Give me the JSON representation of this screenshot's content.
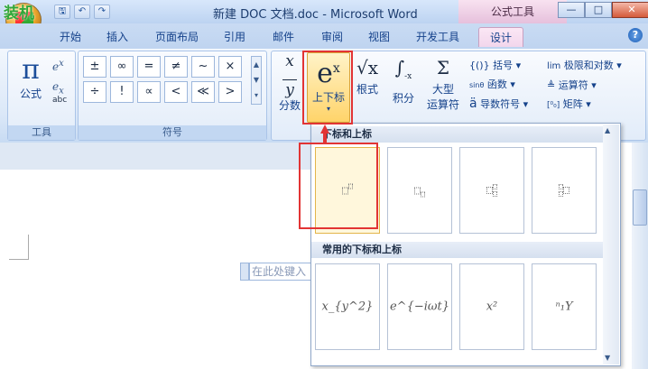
{
  "app": {
    "title": "新建 DOC 文档.doc - Microsoft Word",
    "context_tool": "公式工具",
    "watermark": "装机"
  },
  "qat": {
    "save": "🖫",
    "undo": "↶",
    "redo": "↷"
  },
  "window": {
    "minimize": "—",
    "maximize": "□",
    "close": "✕",
    "help": "?"
  },
  "tabs": [
    "开始",
    "插入",
    "页面布局",
    "引用",
    "邮件",
    "审阅",
    "视图",
    "开发工具",
    "设计"
  ],
  "ribbon": {
    "tools": {
      "label": "工具",
      "eq_label": "公式",
      "pi": "π"
    },
    "symbols": {
      "label": "符号",
      "items": [
        "±",
        "∞",
        "=",
        "≠",
        "~",
        "×",
        "÷",
        "!",
        "∝",
        "<",
        "≪",
        ">"
      ]
    },
    "structures": {
      "fraction": "分数",
      "script": "上下标",
      "radical": "根式",
      "integral": "积分",
      "largeop_line1": "大型",
      "largeop_line2": "运算符",
      "bracket": "括号",
      "function": "函数",
      "accent": "导数符号",
      "limit": "极限和对数",
      "operator": "运算符",
      "matrix": "矩阵"
    }
  },
  "doc": {
    "placeholder": "在此处键入"
  },
  "dropdown": {
    "section1": "下标和上标",
    "section2": "常用的下标和上标",
    "common": [
      "x_{y^2}",
      "e^{−iωt}",
      "x²",
      "ⁿ₁Y"
    ]
  },
  "colors": {
    "accent": "#e23434",
    "ribbon": "#dbe8f8",
    "context": "#f2d6ec"
  }
}
